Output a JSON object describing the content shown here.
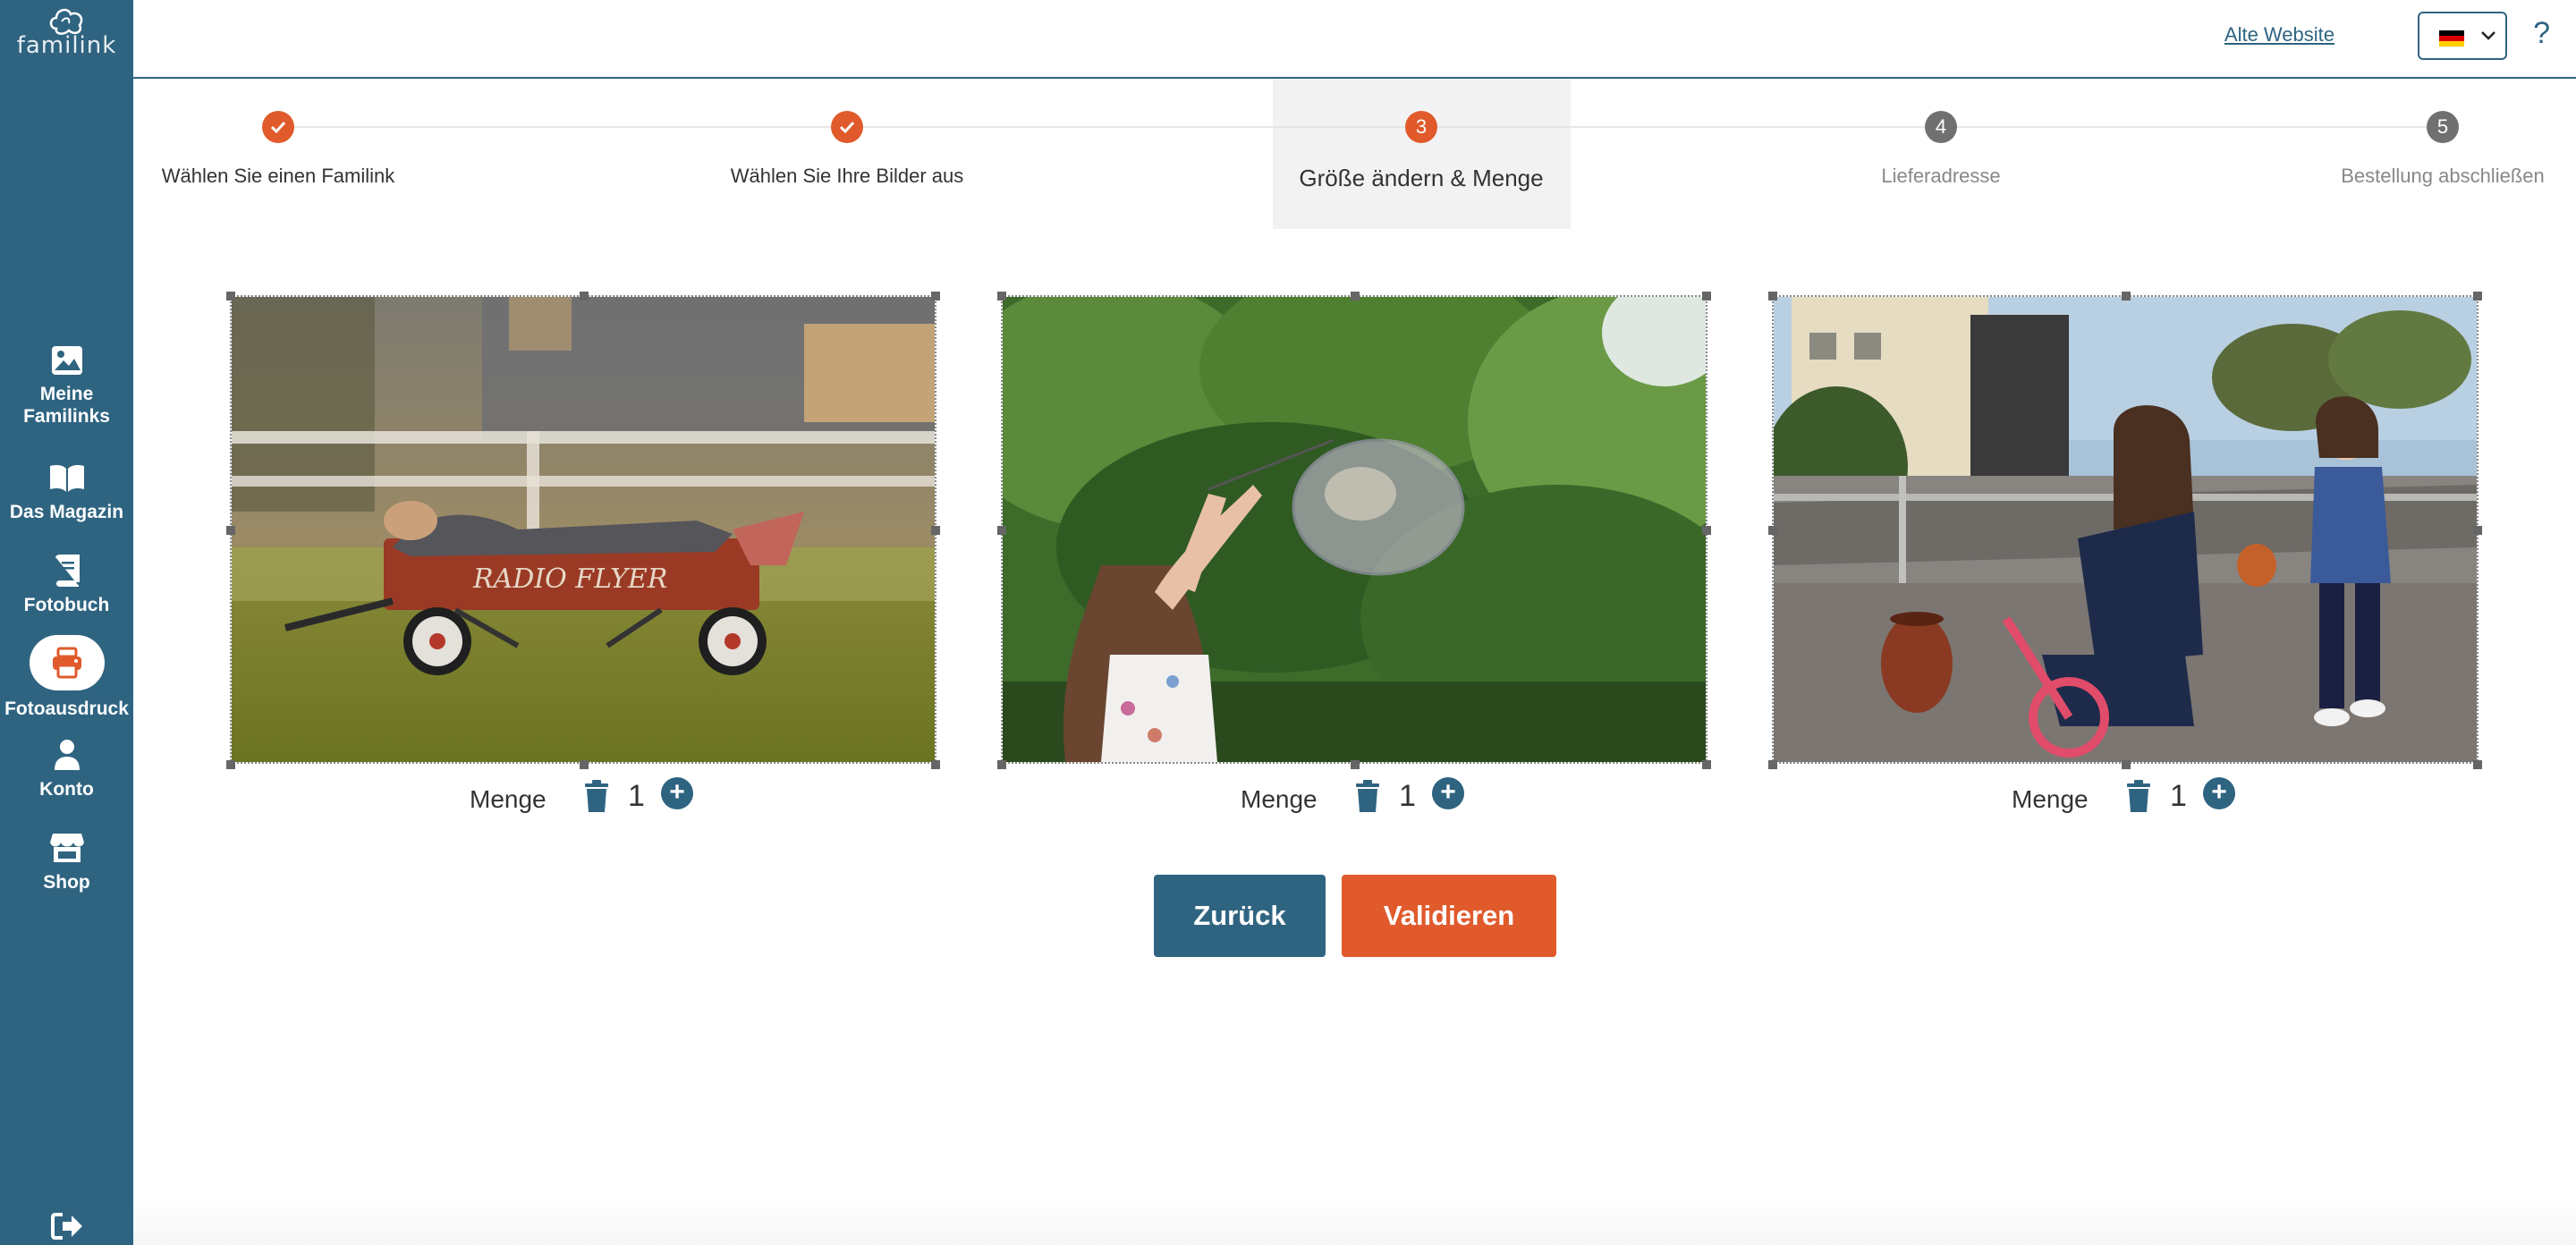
{
  "brand": {
    "logo_text": "familink"
  },
  "sidebar": {
    "items": [
      {
        "label": "Meine Familinks",
        "icon": "image-icon",
        "active": false
      },
      {
        "label": "Das Magazin",
        "icon": "book-open-icon",
        "active": false
      },
      {
        "label": "Fotobuch",
        "icon": "photobook-icon",
        "active": false
      },
      {
        "label": "Fotoausdruck",
        "icon": "printer-icon",
        "active": true
      },
      {
        "label": "Konto",
        "icon": "user-icon",
        "active": false
      },
      {
        "label": "Shop",
        "icon": "store-icon",
        "active": false
      }
    ],
    "logout_icon": "logout-icon"
  },
  "header": {
    "old_site_link": "Alte Website",
    "language": "de",
    "help": "?"
  },
  "stepper": {
    "steps": [
      {
        "number": "1",
        "label": "Wählen Sie einen Familink",
        "state": "done"
      },
      {
        "number": "2",
        "label": "Wählen Sie Ihre Bilder aus",
        "state": "done"
      },
      {
        "number": "3",
        "label": "Größe ändern & Menge",
        "state": "active"
      },
      {
        "number": "4",
        "label": "Lieferadresse",
        "state": "todo"
      },
      {
        "number": "5",
        "label": "Bestellung abschließen",
        "state": "todo"
      }
    ]
  },
  "photos": [
    {
      "quantity_label": "Menge",
      "quantity": "1",
      "wagon_text": "RADIO FLYER"
    },
    {
      "quantity_label": "Menge",
      "quantity": "1"
    },
    {
      "quantity_label": "Menge",
      "quantity": "1"
    }
  ],
  "actions": {
    "back_label": "Zurück",
    "validate_label": "Validieren"
  },
  "colors": {
    "primary": "#2f6481",
    "accent": "#e05a2c",
    "inactive_step": "#707070"
  }
}
